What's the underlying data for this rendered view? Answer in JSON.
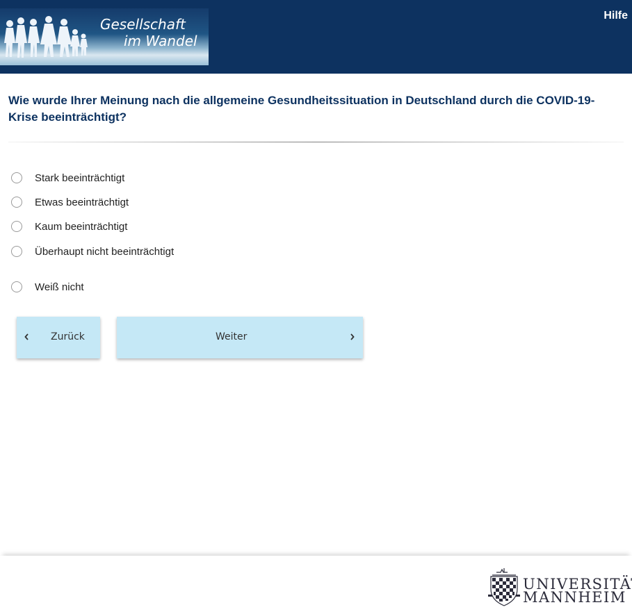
{
  "header": {
    "logo_line1": "Gesellschaft",
    "logo_line2": "im Wandel",
    "help_label": "Hilfe",
    "background_color": "#0d3260"
  },
  "question": {
    "text": "Wie wurde Ihrer Meinung nach die allgemeine Gesundheitssituation in Deutschland durch die COVID-19-Krise beeinträchtigt?"
  },
  "options": [
    {
      "label": "Stark beeinträchtigt",
      "selected": false
    },
    {
      "label": "Etwas beeinträchtigt",
      "selected": false
    },
    {
      "label": "Kaum beeinträchtigt",
      "selected": false
    },
    {
      "label": "Überhaupt nicht beeinträchtigt",
      "selected": false
    },
    {
      "label": "Weiß nicht",
      "selected": false
    }
  ],
  "navigation": {
    "back_label": "Zurück",
    "next_label": "Weiter",
    "back_icon": "chevron-left-icon",
    "next_icon": "chevron-right-icon",
    "button_color": "#c5e8f6"
  },
  "footer": {
    "university_line1": "UNIVERSITÄT",
    "university_line2": "MANNHEIM",
    "crest_icon": "university-crest-icon"
  }
}
